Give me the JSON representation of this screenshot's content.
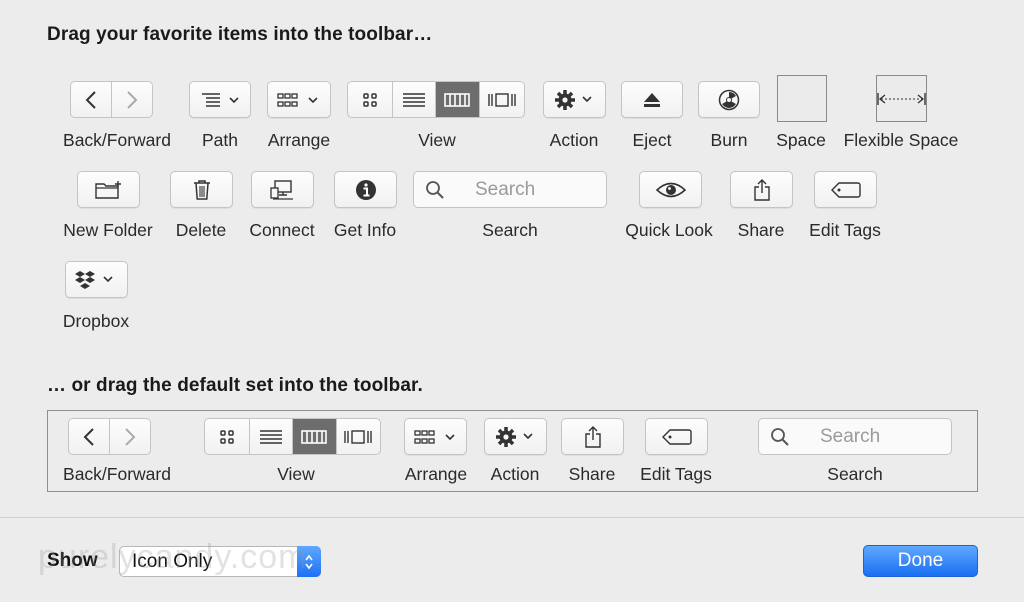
{
  "palette": {
    "heading": "Drag your favorite items into the toolbar…",
    "items": {
      "back_forward": "Back/Forward",
      "path": "Path",
      "arrange": "Arrange",
      "view": "View",
      "action": "Action",
      "eject": "Eject",
      "burn": "Burn",
      "space": "Space",
      "flexible_space": "Flexible Space",
      "new_folder": "New Folder",
      "delete": "Delete",
      "connect": "Connect",
      "get_info": "Get Info",
      "search": "Search",
      "quick_look": "Quick Look",
      "share": "Share",
      "edit_tags": "Edit Tags",
      "dropbox": "Dropbox"
    },
    "search_placeholder": "Search"
  },
  "default_set": {
    "heading": "… or drag the default set into the toolbar.",
    "items": {
      "back_forward": "Back/Forward",
      "view": "View",
      "arrange": "Arrange",
      "action": "Action",
      "share": "Share",
      "edit_tags": "Edit Tags",
      "search": "Search"
    },
    "search_placeholder": "Search"
  },
  "footer": {
    "show_label": "Show",
    "show_value": "Icon Only",
    "done_label": "Done",
    "watermark": "purelycandy.com"
  },
  "colors": {
    "accent": "#1c70f4",
    "selected_segment": "#6d6d6d"
  }
}
